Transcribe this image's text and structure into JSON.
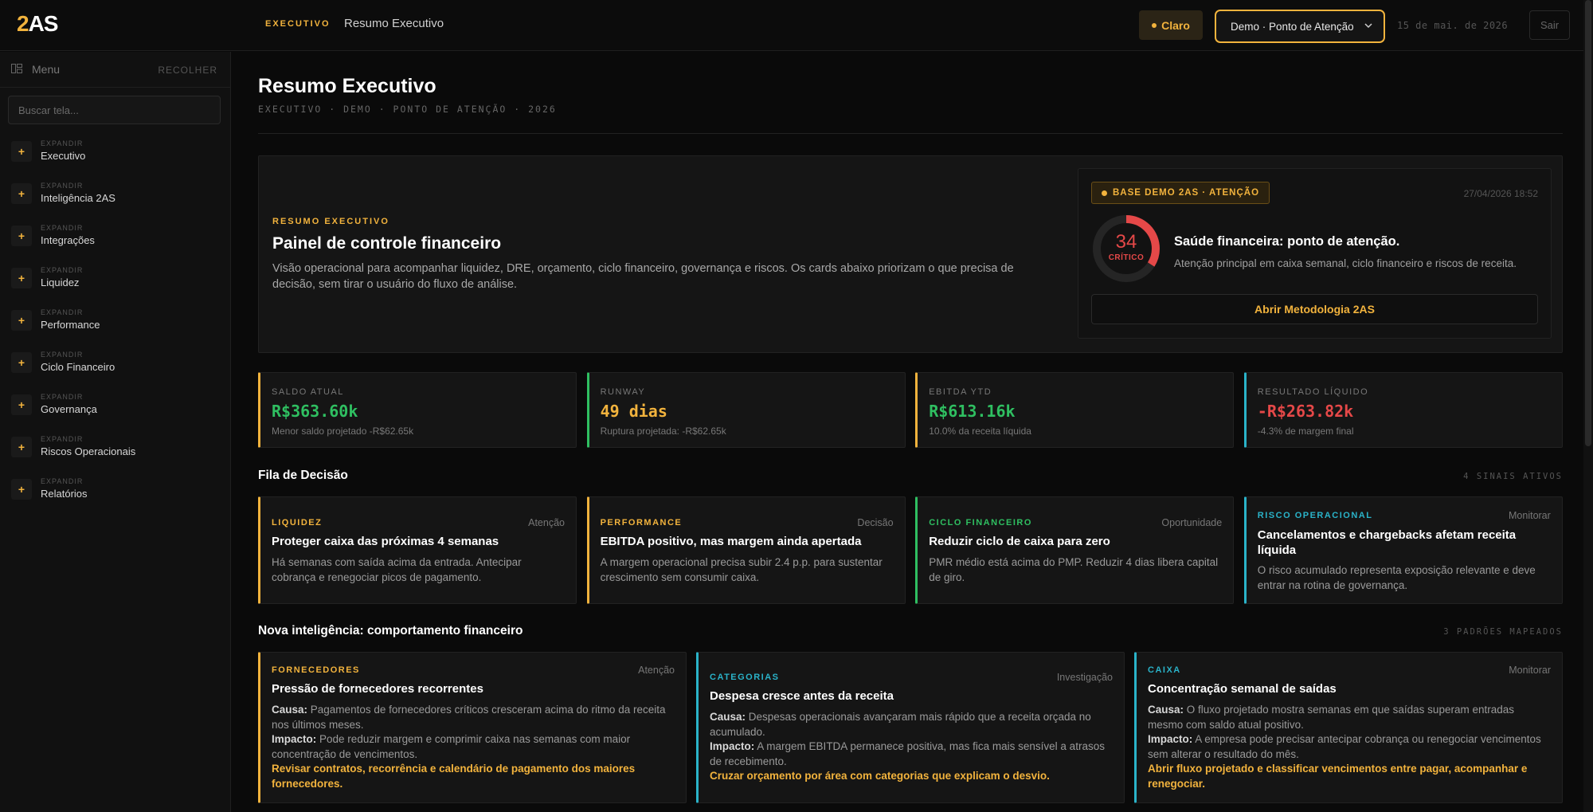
{
  "app": {
    "logo_num": "2",
    "logo_txt": "AS",
    "section": "EXECUTIVO",
    "page": "Resumo Executivo",
    "theme_btn": "Claro",
    "select_value": "Demo · Ponto de Atenção",
    "date": "15 de mai. de 2026",
    "exit": "Sair"
  },
  "sidebar": {
    "menu": "Menu",
    "collapse": "RECOLHER",
    "search_placeholder": "Buscar tela...",
    "expand": "EXPANDIR",
    "items": [
      {
        "label": "Executivo"
      },
      {
        "label": "Inteligência 2AS"
      },
      {
        "label": "Integrações"
      },
      {
        "label": "Liquidez"
      },
      {
        "label": "Performance"
      },
      {
        "label": "Ciclo Financeiro"
      },
      {
        "label": "Governança"
      },
      {
        "label": "Riscos Operacionais"
      },
      {
        "label": "Relatórios"
      }
    ]
  },
  "header": {
    "title": "Resumo Executivo",
    "subtitle": "EXECUTIVO · DEMO · PONTO DE ATENÇÃO · 2026"
  },
  "hero": {
    "eyebrow": "RESUMO EXECUTIVO",
    "title": "Painel de controle financeiro",
    "desc": "Visão operacional para acompanhar liquidez, DRE, orçamento, ciclo financeiro, governança e riscos. Os cards abaixo priorizam o que precisa de decisão, sem tirar o usuário do fluxo de análise.",
    "badge": "BASE DEMO 2AS · ATENÇÃO",
    "timestamp": "27/04/2026 18:52",
    "score": "34",
    "score_label": "CRÍTICO",
    "score_fraction": 0.34,
    "health_title": "Saúde financeira: ponto de atenção.",
    "health_desc": "Atenção principal em caixa semanal, ciclo financeiro e riscos de receita.",
    "method_btn": "Abrir Metodologia 2AS"
  },
  "kpis": [
    {
      "label": "SALDO ATUAL",
      "value": "R$363.60k",
      "sub": "Menor saldo projetado -R$62.65k",
      "color": "#2fbf61",
      "border": "#f2b33d"
    },
    {
      "label": "RUNWAY",
      "value": "49 dias",
      "sub": "Ruptura projetada: -R$62.65k",
      "color": "#f2b33d",
      "border": "#2fbf61"
    },
    {
      "label": "EBITDA YTD",
      "value": "R$613.16k",
      "sub": "10.0% da receita líquida",
      "color": "#2fbf61",
      "border": "#f2b33d"
    },
    {
      "label": "RESULTADO LÍQUIDO",
      "value": "-R$263.82k",
      "sub": "-4.3% de margem final",
      "color": "#e54848",
      "border": "#2ab3c9"
    }
  ],
  "decision": {
    "title": "Fila de Decisão",
    "count": "4 SINAIS ATIVOS",
    "cards": [
      {
        "tag": "LIQUIDEZ",
        "status": "Atenção",
        "title": "Proteger caixa das próximas 4 semanas",
        "desc": "Há semanas com saída acima da entrada. Antecipar cobrança e renegociar picos de pagamento.",
        "color": "#f2b33d"
      },
      {
        "tag": "PERFORMANCE",
        "status": "Decisão",
        "title": "EBITDA positivo, mas margem ainda apertada",
        "desc": "A margem operacional precisa subir 2.4 p.p. para sustentar crescimento sem consumir caixa.",
        "color": "#f2b33d"
      },
      {
        "tag": "CICLO FINANCEIRO",
        "status": "Oportunidade",
        "title": "Reduzir ciclo de caixa para zero",
        "desc": "PMR médio está acima do PMP. Reduzir 4 dias libera capital de giro.",
        "color": "#2fbf61"
      },
      {
        "tag": "RISCO OPERACIONAL",
        "status": "Monitorar",
        "title": "Cancelamentos e chargebacks afetam receita líquida",
        "desc": "O risco acumulado representa exposição relevante e deve entrar na rotina de governança.",
        "color": "#2ab3c9"
      }
    ]
  },
  "intel": {
    "title": "Nova inteligência: comportamento financeiro",
    "count": "3 PADRÕES MAPEADOS",
    "cause_lbl": "Causa:",
    "impact_lbl": "Impacto:",
    "cards": [
      {
        "tag": "FORNECEDORES",
        "status": "Atenção",
        "title": "Pressão de fornecedores recorrentes",
        "cause": "Pagamentos de fornecedores críticos cresceram acima do ritmo da receita nos últimos meses.",
        "impact": "Pode reduzir margem e comprimir caixa nas semanas com maior concentração de vencimentos.",
        "action": "Revisar contratos, recorrência e calendário de pagamento dos maiores fornecedores.",
        "color": "#f2b33d"
      },
      {
        "tag": "CATEGORIAS",
        "status": "Investigação",
        "title": "Despesa cresce antes da receita",
        "cause": "Despesas operacionais avançaram mais rápido que a receita orçada no acumulado.",
        "impact": "A margem EBITDA permanece positiva, mas fica mais sensível a atrasos de recebimento.",
        "action": "Cruzar orçamento por área com categorias que explicam o desvio.",
        "color": "#2ab3c9"
      },
      {
        "tag": "CAIXA",
        "status": "Monitorar",
        "title": "Concentração semanal de saídas",
        "cause": "O fluxo projetado mostra semanas em que saídas superam entradas mesmo com saldo atual positivo.",
        "impact": "A empresa pode precisar antecipar cobrança ou renegociar vencimentos sem alterar o resultado do mês.",
        "action": "Abrir fluxo projetado e classificar vencimentos entre pagar, acompanhar e renegociar.",
        "color": "#2ab3c9"
      }
    ]
  }
}
